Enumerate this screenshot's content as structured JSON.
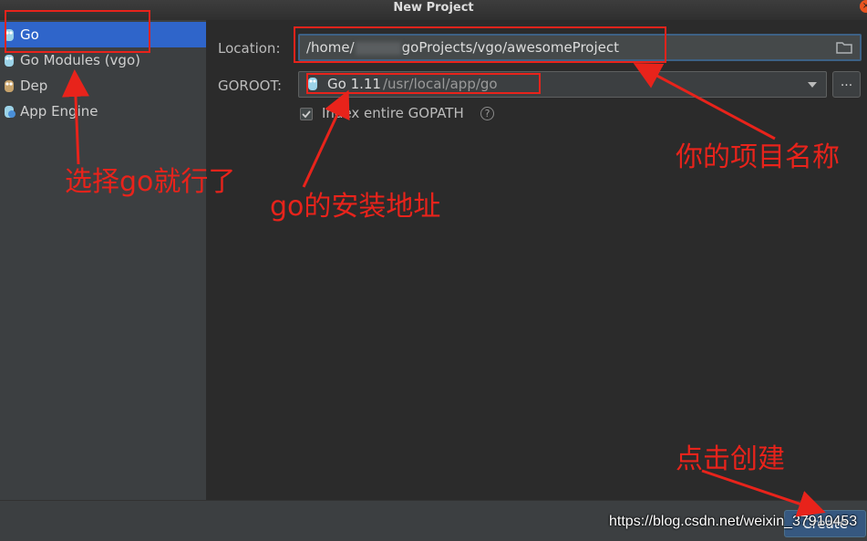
{
  "window": {
    "title": "New Project",
    "close_icon": "close-icon"
  },
  "sidebar": {
    "items": [
      {
        "label": "Go",
        "selected": true,
        "icon": "go-gopher-icon"
      },
      {
        "label": "Go Modules (vgo)",
        "selected": false,
        "icon": "go-gopher-icon"
      },
      {
        "label": "Dep",
        "selected": false,
        "icon": "dep-icon"
      },
      {
        "label": "App Engine",
        "selected": false,
        "icon": "app-engine-icon"
      }
    ]
  },
  "form": {
    "location_label": "Location:",
    "location_value_prefix": "/home/",
    "location_value_suffix": "goProjects/vgo/awesomeProject",
    "goroot_label": "GOROOT:",
    "goroot_version": "Go 1.11",
    "goroot_path": "/usr/local/app/go",
    "browse_label": "...",
    "index_gopath_label": "Index entire GOPATH",
    "index_gopath_checked": true,
    "help_glyph": "?"
  },
  "footer": {
    "create_label": "Create"
  },
  "annotations": {
    "select_go": "选择go就行了",
    "go_install": "go的安装地址",
    "project_name": "你的项目名称",
    "click_create": "点击创建"
  },
  "watermark": "https://blog.csdn.net/weixin_37910453",
  "colors": {
    "accent": "#2f65ca",
    "annotation": "#e8231b",
    "button": "#365880"
  }
}
